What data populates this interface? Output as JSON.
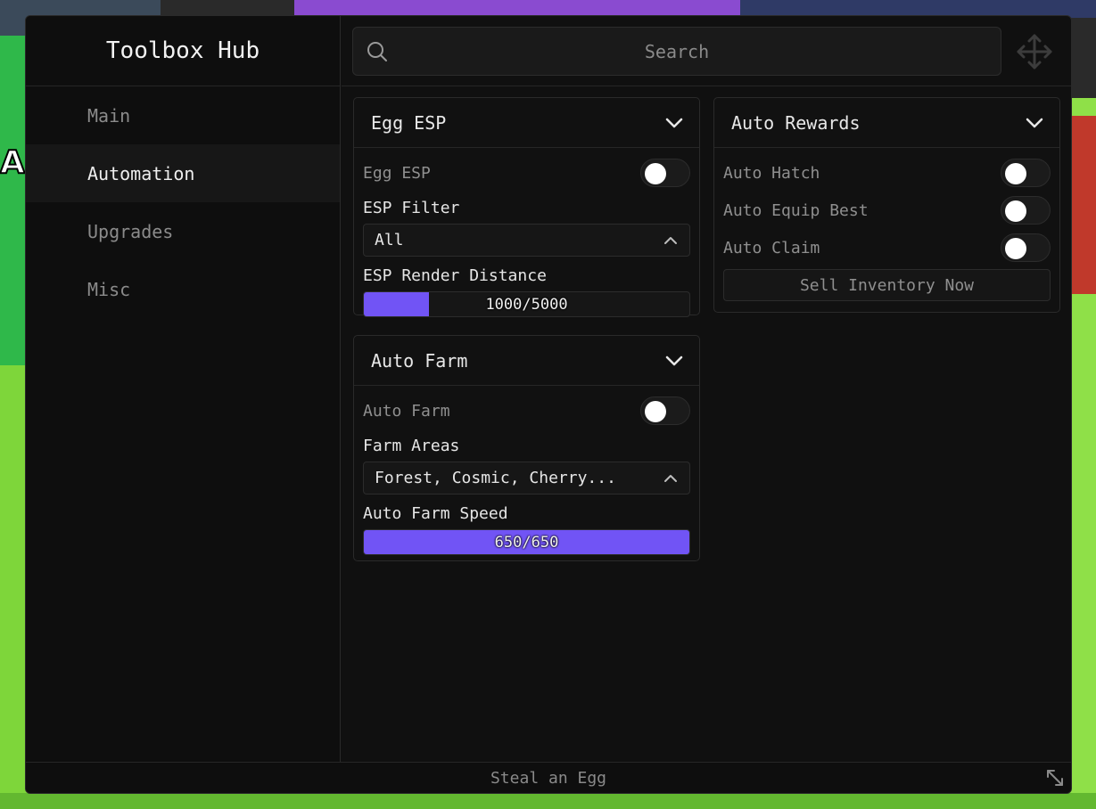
{
  "window": {
    "title": "Toolbox Hub",
    "footer": "Steal an Egg"
  },
  "sidebar": {
    "items": [
      {
        "label": "Main",
        "active": false
      },
      {
        "label": "Automation",
        "active": true
      },
      {
        "label": "Upgrades",
        "active": false
      },
      {
        "label": "Misc",
        "active": false
      }
    ]
  },
  "search": {
    "placeholder": "Search"
  },
  "egg_esp": {
    "title": "Egg ESP",
    "toggle_label": "Egg ESP",
    "toggle_on": false,
    "filter_label": "ESP Filter",
    "filter_value": "All",
    "distance_label": "ESP Render Distance",
    "distance_value": 1000,
    "distance_max": 5000,
    "distance_text": "1000/5000"
  },
  "auto_farm": {
    "title": "Auto Farm",
    "toggle_label": "Auto Farm",
    "toggle_on": false,
    "areas_label": "Farm Areas",
    "areas_value": "Forest, Cosmic, Cherry...",
    "speed_label": "Auto Farm Speed",
    "speed_value": 650,
    "speed_max": 650,
    "speed_text": "650/650"
  },
  "auto_rewards": {
    "title": "Auto Rewards",
    "toggles": [
      {
        "label": "Auto Hatch",
        "on": false
      },
      {
        "label": "Auto Equip Best",
        "on": false
      },
      {
        "label": "Auto Claim",
        "on": false
      }
    ],
    "button_label": "Sell Inventory Now"
  },
  "colors": {
    "accent": "#7154f5",
    "panel": "#101010",
    "text": "#e6e6e6",
    "muted": "#8f8f8f"
  },
  "icons": {
    "search": "search-icon",
    "move": "move-icon",
    "chevron": "chevron-down-icon",
    "caret": "chevron-up-icon",
    "resize": "resize-icon"
  }
}
